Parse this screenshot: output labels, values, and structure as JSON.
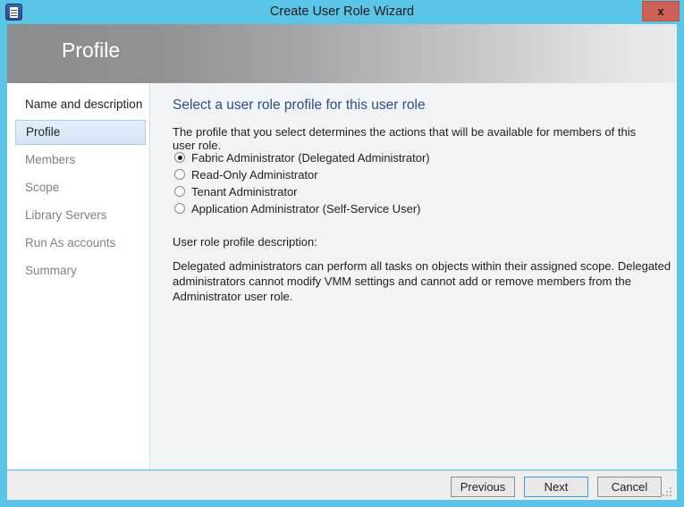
{
  "window": {
    "title": "Create User Role Wizard",
    "icon": "wizard-document-icon",
    "close_label": "x",
    "frame_color": "#5bc5e7",
    "close_button_color": "#cd6155"
  },
  "banner": {
    "title": "Profile",
    "gradient_from": "#8a8c8f",
    "gradient_to": "#eaeaec"
  },
  "sidebar": {
    "items": [
      {
        "label": "Name and description",
        "state": "done"
      },
      {
        "label": "Profile",
        "state": "selected"
      },
      {
        "label": "Members",
        "state": "pending"
      },
      {
        "label": "Scope",
        "state": "pending"
      },
      {
        "label": "Library Servers",
        "state": "pending"
      },
      {
        "label": "Run As accounts",
        "state": "pending"
      },
      {
        "label": "Summary",
        "state": "pending"
      }
    ],
    "selected_bg": "#d5e5f7",
    "selected_border": "#b3cce4"
  },
  "content": {
    "heading": "Select a user role profile for this user role",
    "heading_color": "#2f4d84",
    "subtitle": "The profile that you select determines the actions that will be available for members of this user role.",
    "radio_options": [
      {
        "label": "Fabric Administrator (Delegated Administrator)",
        "checked": true
      },
      {
        "label": "Read-Only Administrator",
        "checked": false
      },
      {
        "label": "Tenant Administrator",
        "checked": false
      },
      {
        "label": "Application Administrator (Self-Service User)",
        "checked": false
      }
    ],
    "description_label": "User role profile description:",
    "description_body": "Delegated administrators can perform all tasks on objects within their assigned scope. Delegated administrators cannot modify VMM settings and cannot add or remove members from the Administrator user role."
  },
  "footer": {
    "previous_label": "Previous",
    "next_label": "Next",
    "cancel_label": "Cancel",
    "default_button": "Next",
    "default_button_border": "#3f9bd6"
  }
}
